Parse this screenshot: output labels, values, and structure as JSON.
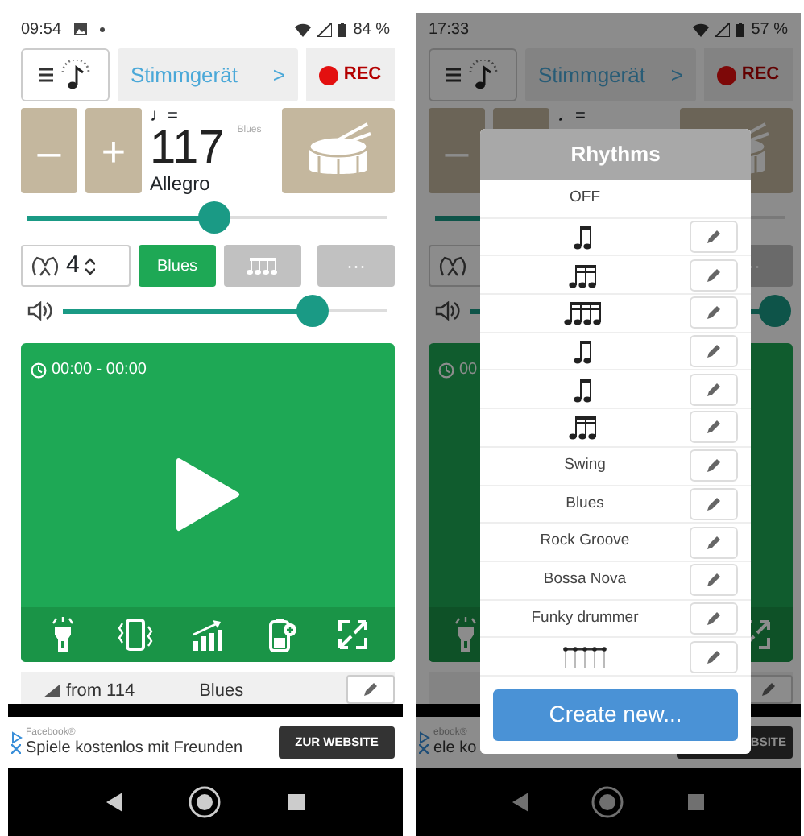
{
  "phones": [
    {
      "status_bar": {
        "time": "09:54",
        "battery": "84 %"
      },
      "top_bar": {
        "tuner_label": "Stimmgerät",
        "chevron": ">",
        "rec_label": "REC"
      },
      "tempo": {
        "minus": "–",
        "plus": "+",
        "note": "♩=",
        "bpm": "117",
        "rhythm": "Blues",
        "marking": "Allegro"
      },
      "tempo_slider": {
        "level": 0.52,
        "thumb": true
      },
      "controls": {
        "beats": "4",
        "rhythm_button": "Blues",
        "notation_button": true,
        "more": "···"
      },
      "volume_slider": {
        "level": 0.77,
        "thumb": true
      },
      "player": {
        "time": "00:00 - 00:00",
        "play_button": true,
        "tools": [
          {
            "kind": "flashlight"
          },
          {
            "kind": "vibrate"
          },
          {
            "kind": "chart"
          },
          {
            "kind": "battery"
          },
          {
            "kind": "fullscreen"
          }
        ]
      },
      "footer_row": {
        "from": "from 114",
        "rhythm": "Blues"
      },
      "ad": {
        "source": "Facebook®",
        "text": "Spiele kostenlos mit Freunden",
        "button": "ZUR WEBSITE"
      }
    },
    {
      "status_bar": {
        "time": "17:33",
        "battery": "57 %"
      },
      "top_bar": {
        "tuner_label": "Stimmgerät",
        "chevron": ">",
        "rec_label": "REC"
      },
      "tempo": {
        "minus": "–",
        "note": "♩="
      },
      "tempo_slider": {
        "level": 0.52
      },
      "controls": {
        "more": "··"
      },
      "volume_slider": {
        "level": 0.97,
        "thumb": true
      },
      "player": {
        "time": "00",
        "tools": [
          {
            "kind": "flashlight"
          },
          {
            "kind": "fullscreen"
          }
        ]
      },
      "ad": {
        "source": "ebook®",
        "text": "ele ko",
        "button": "BSITE"
      },
      "dialog": {
        "title": "Rhythms",
        "create_button": "Create new...",
        "items": [
          {
            "kind": "text",
            "label": "OFF",
            "editable": false
          },
          {
            "kind": "notation",
            "editable": true
          },
          {
            "kind": "notation",
            "editable": true
          },
          {
            "kind": "notation",
            "editable": true
          },
          {
            "kind": "notation",
            "editable": true
          },
          {
            "kind": "notation",
            "editable": true
          },
          {
            "kind": "notation",
            "editable": true
          },
          {
            "kind": "text",
            "label": "Swing",
            "editable": true
          },
          {
            "kind": "text",
            "label": "Blues",
            "editable": true
          },
          {
            "kind": "text",
            "label": "Rock Groove",
            "editable": true
          },
          {
            "kind": "text",
            "label": "Bossa Nova",
            "editable": true
          },
          {
            "kind": "text",
            "label": "Funky drummer",
            "editable": true
          },
          {
            "kind": "staff",
            "editable": true
          }
        ]
      }
    }
  ]
}
